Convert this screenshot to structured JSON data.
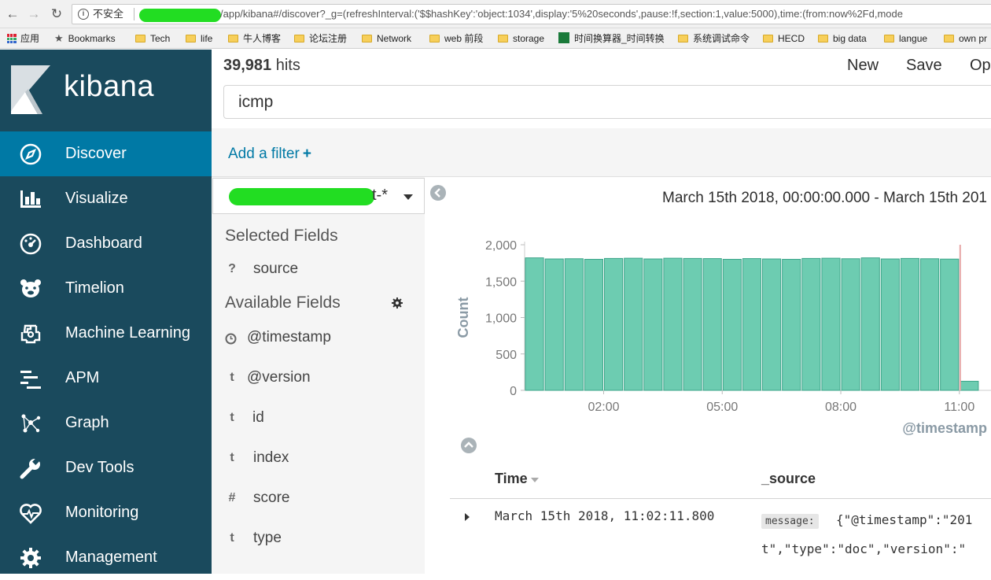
{
  "browser": {
    "back_icon": "arrow-left-icon",
    "forward_icon": "arrow-right-icon",
    "reload_icon": "reload-icon",
    "security_label": "不安全",
    "url_path": "/app/kibana#/discover?_g=(refreshInterval:('$$hashKey':'object:1034',display:'5%20seconds',pause:!f,section:1,value:5000),time:(from:now%2Fd,mode"
  },
  "bookmarks": [
    {
      "label": "应用",
      "icon": "apps-grid-icon"
    },
    {
      "label": "Bookmarks",
      "icon": "star-icon"
    },
    {
      "label": "Tech",
      "icon": "folder-icon"
    },
    {
      "label": "life",
      "icon": "folder-icon"
    },
    {
      "label": "牛人博客",
      "icon": "folder-icon"
    },
    {
      "label": "论坛注册",
      "icon": "folder-icon"
    },
    {
      "label": "Network",
      "icon": "folder-icon"
    },
    {
      "label": "web 前段",
      "icon": "folder-icon"
    },
    {
      "label": "storage",
      "icon": "folder-icon"
    },
    {
      "label": "时间换算器_时间转换",
      "icon": "app-icon"
    },
    {
      "label": "系统调试命令",
      "icon": "folder-icon"
    },
    {
      "label": "HECD",
      "icon": "folder-icon"
    },
    {
      "label": "big data",
      "icon": "folder-icon"
    },
    {
      "label": "langue",
      "icon": "folder-icon"
    },
    {
      "label": "own pr",
      "icon": "folder-icon"
    }
  ],
  "sidebar": {
    "brand": "kibana",
    "items": [
      {
        "label": "Discover",
        "icon": "compass-icon",
        "active": true
      },
      {
        "label": "Visualize",
        "icon": "bar-chart-icon",
        "active": false
      },
      {
        "label": "Dashboard",
        "icon": "dashboard-icon",
        "active": false
      },
      {
        "label": "Timelion",
        "icon": "timelion-bear-icon",
        "active": false
      },
      {
        "label": "Machine Learning",
        "icon": "machine-learning-icon",
        "active": false
      },
      {
        "label": "APM",
        "icon": "apm-icon",
        "active": false
      },
      {
        "label": "Graph",
        "icon": "graph-icon",
        "active": false
      },
      {
        "label": "Dev Tools",
        "icon": "wrench-icon",
        "active": false
      },
      {
        "label": "Monitoring",
        "icon": "heartbeat-icon",
        "active": false
      },
      {
        "label": "Management",
        "icon": "gear-icon",
        "active": false
      }
    ]
  },
  "toolbar": {
    "hits_count": "39,981",
    "hits_label": " hits",
    "new_label": "New",
    "save_label": "Save",
    "open_label": "Op"
  },
  "search": {
    "query": "icmp"
  },
  "filters": {
    "add_filter_label": "Add a filter",
    "add_filter_plus": "+"
  },
  "index_pattern": {
    "suffix": "t-*"
  },
  "fields": {
    "selected_title": "Selected Fields",
    "selected": [
      {
        "type": "?",
        "name": "source"
      }
    ],
    "available_title": "Available Fields",
    "available": [
      {
        "type": "clock",
        "name": "@timestamp"
      },
      {
        "type": "t",
        "name": "@version"
      },
      {
        "type": "t",
        "name": "id"
      },
      {
        "type": "t",
        "name": "index"
      },
      {
        "type": "#",
        "name": "score"
      },
      {
        "type": "t",
        "name": "type"
      }
    ]
  },
  "time_range": "March 15th 2018, 00:00:00.000 - March 15th 201",
  "colors": {
    "sidebar": "#1a4a5d",
    "active": "#0079a5",
    "bar_fill": "#6dccb1",
    "bar_stroke": "#3da58a",
    "now_marker": "#e7a6a6"
  },
  "chart_data": {
    "type": "bar",
    "xlabel": "@timestamp",
    "ylabel": "Count",
    "ylim": [
      0,
      2000
    ],
    "yticks": [
      0,
      500,
      1000,
      1500,
      2000
    ],
    "ytick_labels": [
      "0",
      "500",
      "1,000",
      "1,500",
      "2,000"
    ],
    "xticks": [
      2,
      5,
      8,
      11
    ],
    "xtick_labels": [
      "02:00",
      "05:00",
      "08:00",
      "11:00"
    ],
    "x": [
      0.25,
      0.75,
      1.25,
      1.75,
      2.25,
      2.75,
      3.25,
      3.75,
      4.25,
      4.75,
      5.25,
      5.75,
      6.25,
      6.75,
      7.25,
      7.75,
      8.25,
      8.75,
      9.25,
      9.75,
      10.25,
      10.75,
      11.25
    ],
    "values": [
      1820,
      1805,
      1808,
      1800,
      1812,
      1815,
      1805,
      1815,
      1812,
      1810,
      1800,
      1810,
      1805,
      1800,
      1812,
      1815,
      1808,
      1820,
      1805,
      1812,
      1808,
      1803,
      125
    ],
    "now_marker": 11.02,
    "xlim": [
      0,
      11.8
    ]
  },
  "doc_table": {
    "time_header": "Time",
    "source_header": "_source",
    "rows": [
      {
        "time": "March 15th 2018, 11:02:11.800",
        "message_key": "message:",
        "source_line1": "{\"@timestamp\":\"201",
        "source_line2": "t\",\"type\":\"doc\",\"version\":\""
      }
    ]
  }
}
